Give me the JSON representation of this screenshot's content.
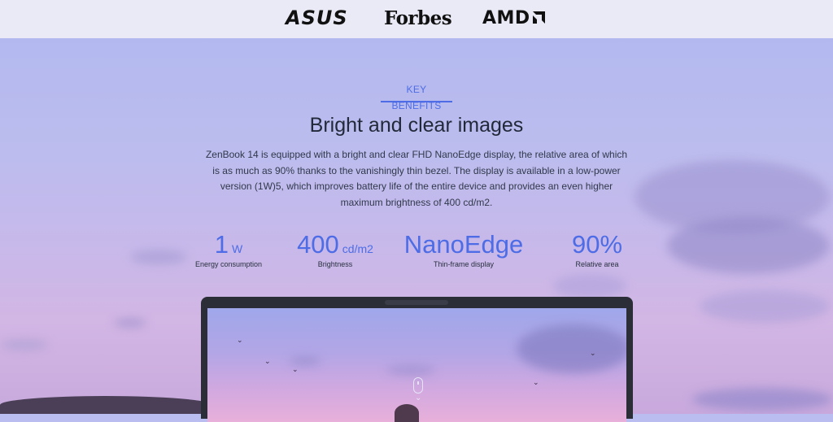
{
  "brand_bar": {
    "logos": [
      "ASUS",
      "Forbes",
      "AMD"
    ]
  },
  "section": {
    "eyebrow": "KEY BENEFITS",
    "title": "Bright and clear images",
    "description": "ZenBook 14 is equipped with a bright and clear FHD NanoEdge display, the relative area of which is as much as 90% thanks to the vanishingly thin bezel. The display is available in a low-power version (1W)5, which improves battery life of the entire device and provides an even higher maximum brightness of 400 cd/m2."
  },
  "stats": [
    {
      "value": "1",
      "unit": "W",
      "caption": "Energy consumption"
    },
    {
      "value": "400",
      "unit": "cd/m2",
      "caption": "Brightness"
    },
    {
      "value": "NanoEdge",
      "unit": "",
      "caption": "Thin-frame display"
    },
    {
      "value": "90%",
      "unit": "",
      "caption": "Relative area"
    }
  ],
  "colors": {
    "accent": "#4d6ce6",
    "logo_bar_bg": "#e9eaf6",
    "laptop_bezel": "#2b2e37"
  },
  "icons": {
    "scroll_hint": "mouse-scroll-icon",
    "chevron": "chevron-down-icon"
  }
}
